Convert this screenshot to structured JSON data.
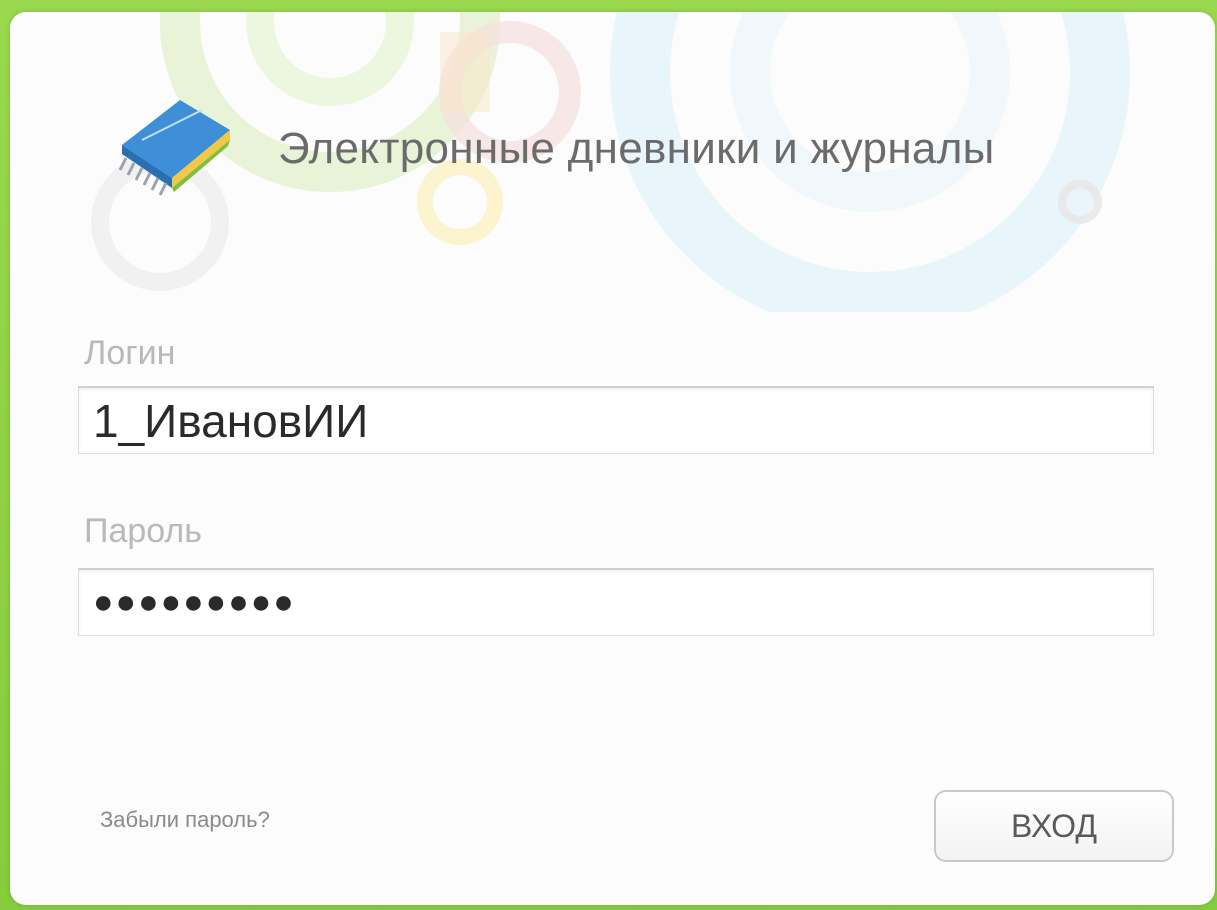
{
  "app": {
    "title": "Электронные дневники и журналы",
    "logo_icon": "book-icon"
  },
  "form": {
    "login_label": "Логин",
    "login_value": "1_ИвановИИ",
    "password_label": "Пароль",
    "password_value": "●●●●●●●●●",
    "forgot_link": "Забыли пароль?",
    "submit_label": "ВХОД"
  },
  "colors": {
    "frame": "#8fd24a",
    "card": "#fbfcfb",
    "logo_blue": "#3e8fd8"
  }
}
